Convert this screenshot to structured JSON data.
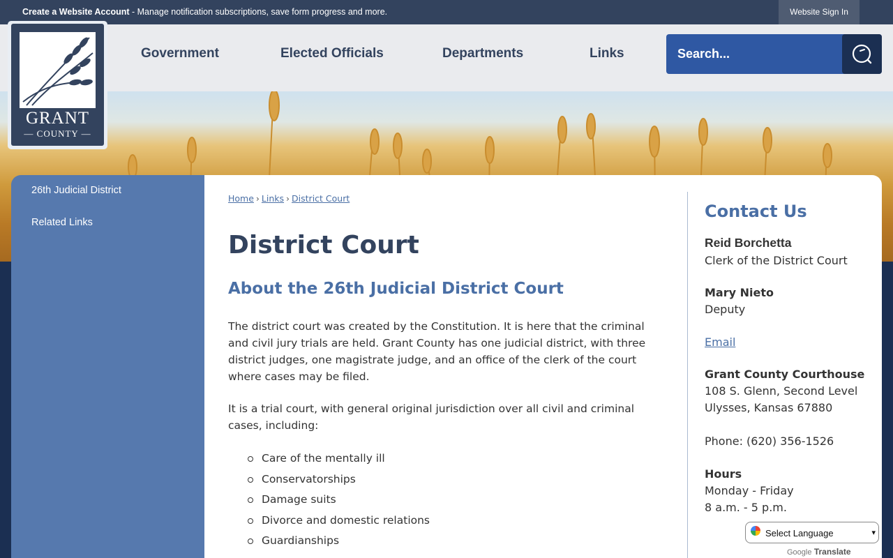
{
  "topbar": {
    "account_bold": "Create a Website Account",
    "account_rest": " - Manage notification subscriptions, save form progress and more.",
    "signin": "Website Sign In"
  },
  "logo": {
    "name": "GRANT",
    "sub": "— COUNTY —"
  },
  "nav": [
    {
      "label": "Government"
    },
    {
      "label": "Elected Officials"
    },
    {
      "label": "Departments"
    },
    {
      "label": "Links"
    }
  ],
  "search": {
    "placeholder": "Search..."
  },
  "sidenav": [
    {
      "label": "26th Judicial District"
    },
    {
      "label": "Related Links"
    }
  ],
  "breadcrumb": {
    "home": "Home",
    "links": "Links",
    "current": "District Court",
    "sep": "›"
  },
  "page": {
    "title": "District Court",
    "subhead": "About the 26th Judicial District Court",
    "para1": "The district court was created by the Constitution. It is here that the criminal and civil jury trials are held. Grant County has one judicial district, with three district judges, one magistrate judge, and an office of the clerk of the court where cases may be filed.",
    "para2": "It is a trial court, with general original jurisdiction over all civil and criminal cases, including:",
    "list": [
      "Care of the mentally ill",
      "Conservatorships",
      "Damage suits",
      "Divorce and domestic relations",
      "Guardianships"
    ]
  },
  "contact": {
    "heading": "Contact Us",
    "name1": "Reid Borchetta",
    "title1": "Clerk of the District Court",
    "name2": "Mary Nieto",
    "title2": "Deputy",
    "email": "Email",
    "building": "Grant County Courthouse",
    "address1": "108 S. Glenn, Second Level",
    "address2": "Ulysses, Kansas 67880",
    "phone": "Phone: (620) 356-1526",
    "hours_label": "Hours",
    "hours_days": "Monday - Friday",
    "hours_time": "8 a.m. - 5 p.m."
  },
  "translate": {
    "label": "Select Language",
    "powered": "Google",
    "action": "Translate"
  },
  "colors": {
    "nav_text": "#33435e",
    "accent": "#4a6fa5",
    "sidenav": "#5679ae",
    "search": "#2f58a3"
  }
}
